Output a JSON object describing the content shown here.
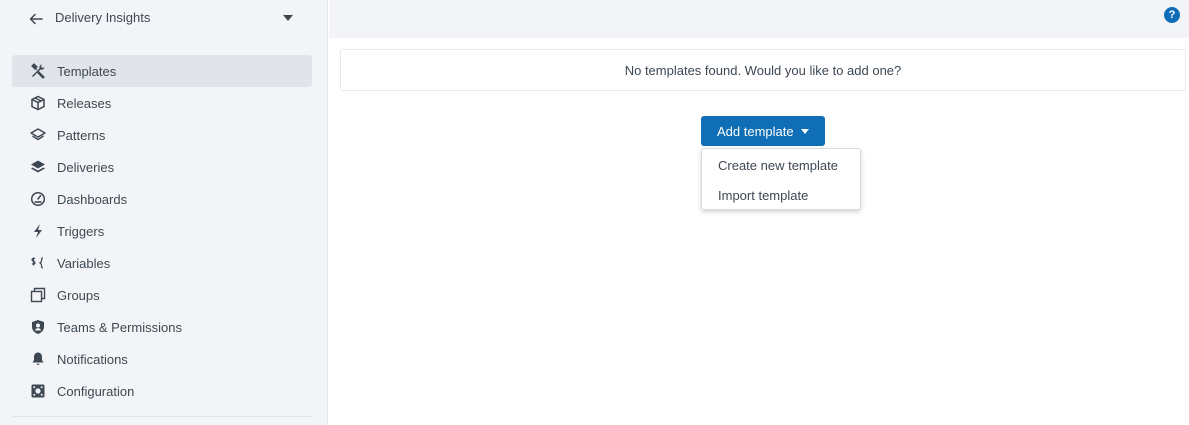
{
  "header": {
    "title": "Delivery Insights"
  },
  "sidebar": {
    "items": [
      {
        "label": "Templates",
        "icon": "tools-icon",
        "active": true
      },
      {
        "label": "Releases",
        "icon": "cube-icon"
      },
      {
        "label": "Patterns",
        "icon": "layers-outline-icon"
      },
      {
        "label": "Deliveries",
        "icon": "layers-filled-icon"
      },
      {
        "label": "Dashboards",
        "icon": "gauge-icon"
      },
      {
        "label": "Triggers",
        "icon": "bolt-icon"
      },
      {
        "label": "Variables",
        "icon": "variable-icon"
      },
      {
        "label": "Groups",
        "icon": "copy-icon"
      },
      {
        "label": "Teams & Permissions",
        "icon": "shield-user-icon"
      },
      {
        "label": "Notifications",
        "icon": "bell-icon"
      },
      {
        "label": "Configuration",
        "icon": "config-icon"
      }
    ]
  },
  "topbar": {
    "help_glyph": "?"
  },
  "main": {
    "empty_message": "No templates found. Would you like to add one?",
    "add_button_label": "Add template",
    "menu": [
      {
        "label": "Create new template"
      },
      {
        "label": "Import template"
      }
    ]
  },
  "colors": {
    "accent": "#0f6eb5",
    "sidebar_bg": "#f3f4f7",
    "text": "#3d4853"
  }
}
